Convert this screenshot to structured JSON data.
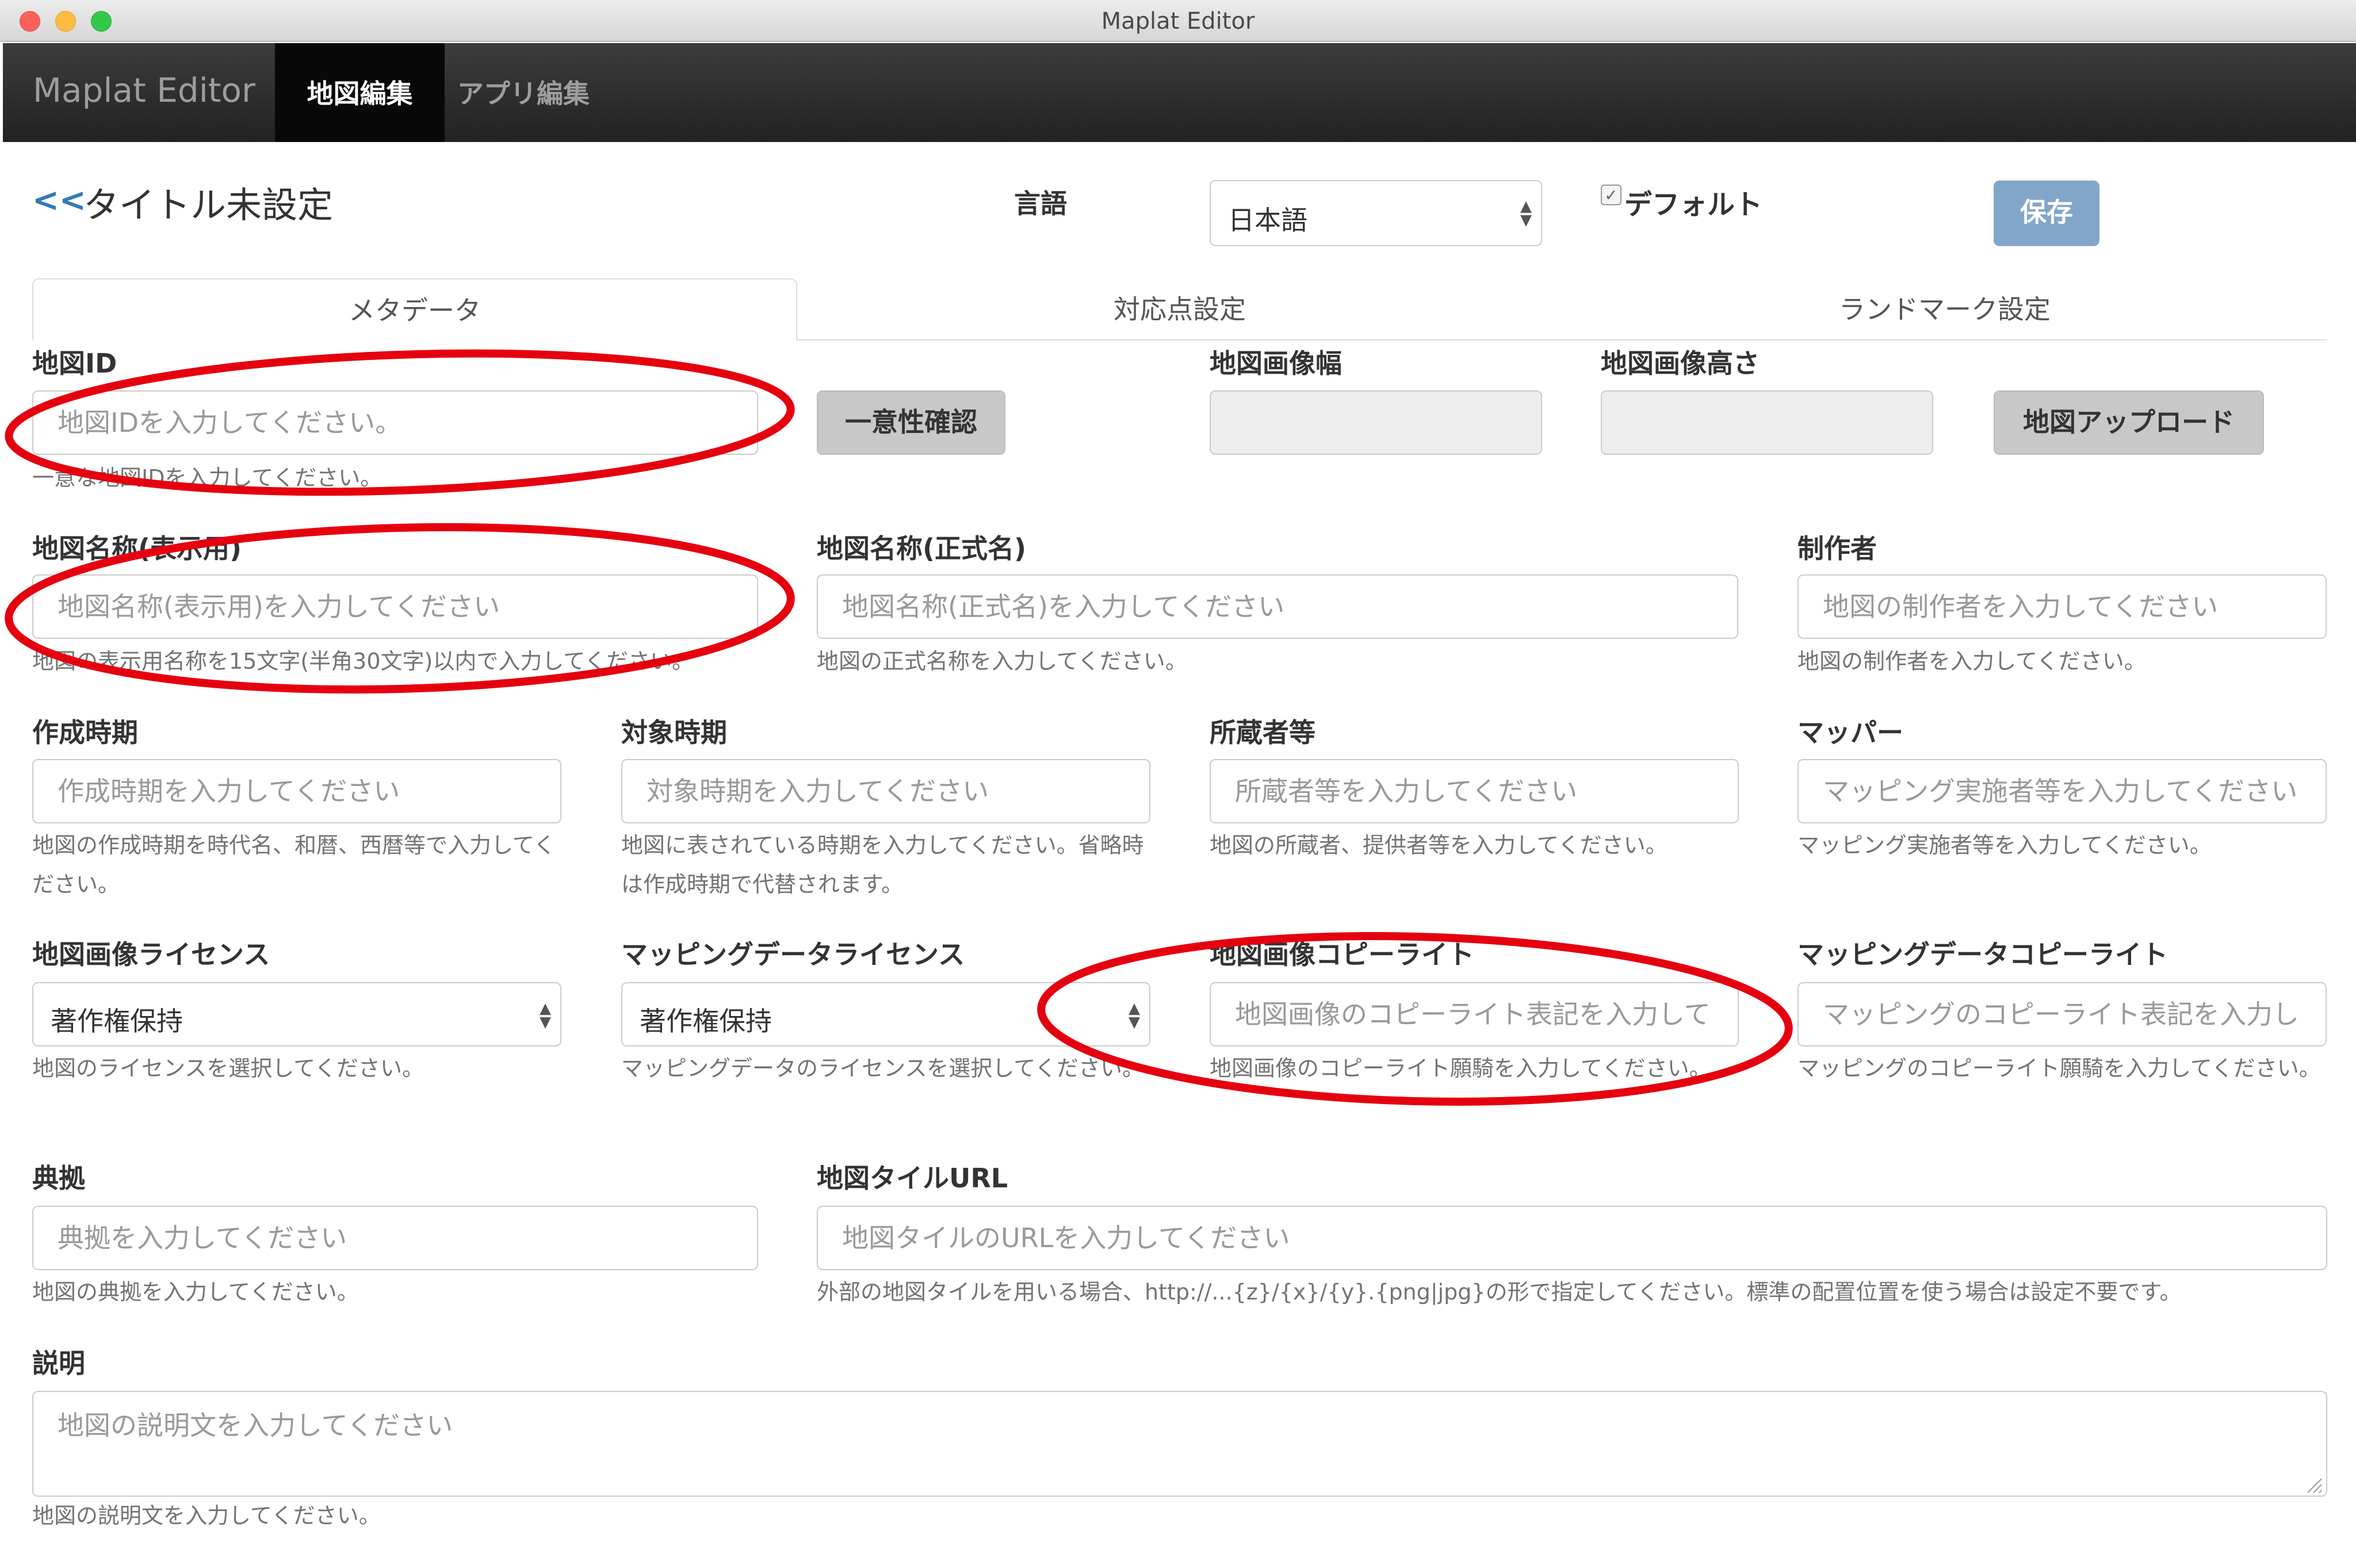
{
  "window": {
    "title": "Maplat Editor"
  },
  "navbar": {
    "brand": "Maplat Editor",
    "items": [
      {
        "label": "地図編集"
      },
      {
        "label": "アプリ編集"
      }
    ]
  },
  "header": {
    "back": "<<",
    "title": "タイトル未設定",
    "language_label": "言語",
    "language_value": "日本語",
    "default_label": "デフォルト",
    "default_checked": true,
    "save": "保存"
  },
  "tabs": [
    {
      "label": "メタデータ"
    },
    {
      "label": "対応点設定"
    },
    {
      "label": "ランドマーク設定"
    }
  ],
  "form": {
    "map_id": {
      "label": "地図ID",
      "placeholder": "地図IDを入力してください。",
      "help": "一意な地図IDを入力してください。"
    },
    "unique_check": "一意性確認",
    "width": {
      "label": "地図画像幅",
      "value": ""
    },
    "height": {
      "label": "地図画像高さ",
      "value": ""
    },
    "upload": "地図アップロード",
    "display_name": {
      "label": "地図名称(表示用)",
      "placeholder": "地図名称(表示用)を入力してください",
      "help": "地図の表示用名称を15文字(半角30文字)以内で入力してください。"
    },
    "official_name": {
      "label": "地図名称(正式名)",
      "placeholder": "地図名称(正式名)を入力してください",
      "help": "地図の正式名称を入力してください。"
    },
    "author": {
      "label": "制作者",
      "placeholder": "地図の制作者を入力してください",
      "help": "地図の制作者を入力してください。"
    },
    "created_at": {
      "label": "作成時期",
      "placeholder": "作成時期を入力してください",
      "help": "地図の作成時期を時代名、和暦、西暦等で入力してください。"
    },
    "era": {
      "label": "対象時期",
      "placeholder": "対象時期を入力してください",
      "help": "地図に表されている時期を入力してください。省略時は作成時期で代替されます。"
    },
    "owner": {
      "label": "所蔵者等",
      "placeholder": "所蔵者等を入力してください",
      "help": "地図の所蔵者、提供者等を入力してください。"
    },
    "mapper": {
      "label": "マッパー",
      "placeholder": "マッピング実施者等を入力してください",
      "help": "マッピング実施者等を入力してください。"
    },
    "image_license": {
      "label": "地図画像ライセンス",
      "value": "著作権保持",
      "help": "地図のライセンスを選択してください。"
    },
    "data_license": {
      "label": "マッピングデータライセンス",
      "value": "著作権保持",
      "help": "マッピングデータのライセンスを選択してください。"
    },
    "image_copyright": {
      "label": "地図画像コピーライト",
      "placeholder": "地図画像のコピーライト表記を入力して",
      "help": "地図画像のコピーライト願騎を入力してください。"
    },
    "data_copyright": {
      "label": "マッピングデータコピーライト",
      "placeholder": "マッピングのコピーライト表記を入力し",
      "help": "マッピングのコピーライト願騎を入力してください。"
    },
    "source": {
      "label": "典拠",
      "placeholder": "典拠を入力してください",
      "help": "地図の典拠を入力してください。"
    },
    "tile_url": {
      "label": "地図タイルURL",
      "placeholder": "地図タイルのURLを入力してください",
      "help": "外部の地図タイルを用いる場合、http://...{z}/{x}/{y}.{png|jpg}の形で指定してください。標準の配置位置を使う場合は設定不要です。"
    },
    "description": {
      "label": "説明",
      "placeholder": "地図の説明文を入力してください",
      "help": "地図の説明文を入力してください。"
    }
  },
  "annotation_color": "#e5000f"
}
